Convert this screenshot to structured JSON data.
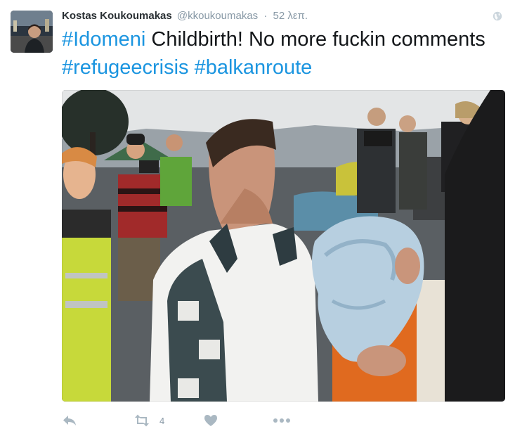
{
  "tweet": {
    "author_name": "Kostas Koukoumakas",
    "author_handle": "@kkoukoumakas",
    "separator": "·",
    "timestamp": "52 λεπ.",
    "text_parts": {
      "hashtag_1": "#Idomeni",
      "body": " Childbirth! No more fuckin comments ",
      "hashtag_2": "#refugeecrisis",
      "space": " ",
      "hashtag_3": "#balkanroute"
    },
    "media": {
      "kind": "photo"
    },
    "actions": {
      "reply_icon": "reply-icon",
      "retweet_icon": "retweet-icon",
      "retweet_count": "4",
      "like_icon": "heart-icon",
      "more_icon": "more-dots-icon"
    }
  },
  "colors": {
    "name": "#292f33",
    "meta": "#8899a6",
    "hashtag": "#1b95e0",
    "action_icon": "#aab8c2"
  }
}
